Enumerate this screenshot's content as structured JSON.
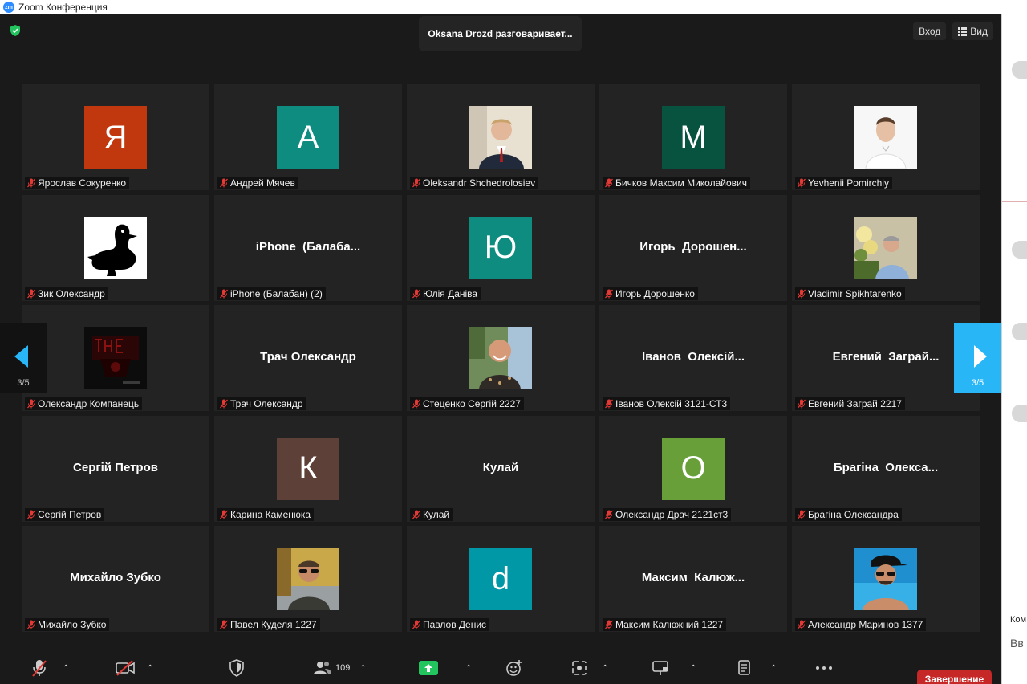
{
  "window": {
    "app_logo": "zm",
    "title": "Zoom Конференция"
  },
  "header": {
    "speaker_banner": "Oksana Drozd разговаривает...",
    "enter_button": "Вход",
    "view_button": "Вид"
  },
  "navigation": {
    "left_page": "3/5",
    "right_page": "3/5"
  },
  "tiles": [
    {
      "label": "Ярослав Сокуренко",
      "avatar_letter": "Я",
      "avatar_color": "#c1380e"
    },
    {
      "label": "Андрей Мячев",
      "avatar_letter": "А",
      "avatar_color": "#0f8c80"
    },
    {
      "label": "Oleksandr Shchedrolosiev",
      "photo": "man-suit-photo"
    },
    {
      "label": "Бичков Максим Миколайович",
      "avatar_letter": "М",
      "avatar_color": "#08533f"
    },
    {
      "label": "Yevhenii Pomirchiy",
      "photo": "man-white-shirt-photo"
    },
    {
      "label": "Зик Олександр",
      "photo": "duck-silhouette-image"
    },
    {
      "label": "iPhone (Балабан) (2)",
      "display_name": "iPhone  (Балаба..."
    },
    {
      "label": "Юлія Данiва",
      "avatar_letter": "Ю",
      "avatar_color": "#0f8c80"
    },
    {
      "label": "Игорь Дорошенко",
      "display_name": "Игорь  Дорошен..."
    },
    {
      "label": "Vladimir Spikhtarenko",
      "photo": "man-flowers-photo"
    },
    {
      "label": "Олександр Компанець",
      "photo": "dark-red-poster-image"
    },
    {
      "label": "Трач Олександр",
      "display_name": "Трач Олександр"
    },
    {
      "label": "Стеценко Сергій 2227",
      "photo": "smiling-man-photo"
    },
    {
      "label": "Іванов Олексій 3121-СТ3",
      "display_name": "Іванов  Олексій..."
    },
    {
      "label": "Евгений Заграй 2217",
      "display_name": "Евгений  Заграй..."
    },
    {
      "label": "Сергій Петров",
      "display_name": "Сергій Петров"
    },
    {
      "label": "Карина Каменюка",
      "avatar_letter": "К",
      "avatar_color": "#5d4037"
    },
    {
      "label": "Кулай",
      "display_name": "Кулай"
    },
    {
      "label": "Олександр Драч 2121ст3",
      "avatar_letter": "О",
      "avatar_color": "#689f38"
    },
    {
      "label": "Брагіна Олександра",
      "display_name": "Брагіна  Олекса..."
    },
    {
      "label": "Михайло Зубко",
      "display_name": "Михайло Зубко"
    },
    {
      "label": "Павел Куделя 1227",
      "photo": "man-sunglasses-photo"
    },
    {
      "label": "Павлов Денис",
      "avatar_letter": "d",
      "avatar_color": "#0097a7"
    },
    {
      "label": "Максим Калюжний 1227",
      "display_name": "Максим  Калюж..."
    },
    {
      "label": "Александр Маринов 1377",
      "photo": "man-cap-pool-photo"
    }
  ],
  "toolbar": {
    "participants_count": "109",
    "end_button": "Завершение"
  },
  "side_panel": {
    "text1": "Ком",
    "text2": "Вв"
  },
  "colors": {
    "accent_blue": "#29b6f6",
    "end_red": "#c62828",
    "mute_red": "#e53935",
    "share_green": "#22c55e"
  }
}
